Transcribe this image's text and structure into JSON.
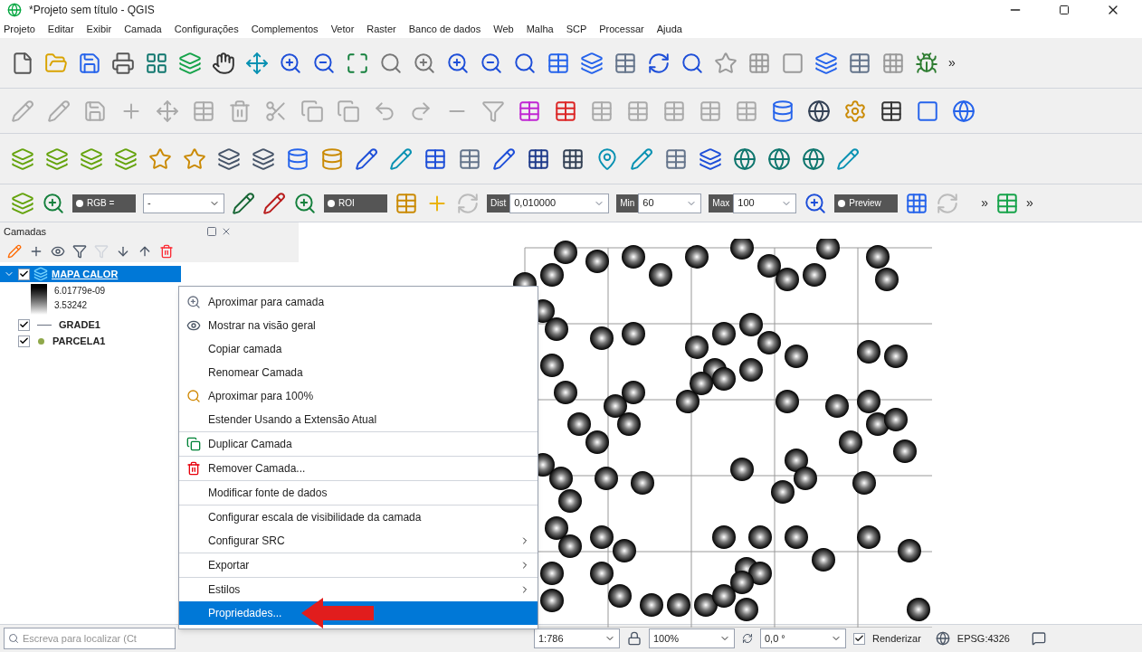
{
  "window": {
    "title": "*Projeto sem título - QGIS"
  },
  "menu": [
    "Projeto",
    "Editar",
    "Exibir",
    "Camada",
    "Configurações",
    "Complementos",
    "Vetor",
    "Raster",
    "Banco de dados",
    "Web",
    "Malha",
    "SCP",
    "Processar",
    "Ajuda"
  ],
  "toolbar_overflow": "»",
  "scp_toolbar": {
    "rgb_label": "RGB =",
    "rgb_value": "-",
    "roi_label": "ROI",
    "dist_label": "Dist",
    "dist_value": "0,010000",
    "min_label": "Min",
    "min_value": "60",
    "max_label": "Max",
    "max_value": "100",
    "preview_label": "Preview",
    "overflow": "»",
    "overflow_end": "»"
  },
  "layers_panel": {
    "title": "Camadas",
    "layers": [
      {
        "name": "MAPA CALOR",
        "kind": "raster",
        "checked": true,
        "selected": true,
        "expanded": true,
        "legend": [
          "6.01779e-09",
          "3.53242"
        ]
      },
      {
        "name": "GRADE1",
        "kind": "line",
        "checked": true,
        "selected": false
      },
      {
        "name": "PARCELA1",
        "kind": "point",
        "checked": true,
        "selected": false
      }
    ]
  },
  "context_menu": {
    "groups": [
      [
        {
          "label": "Aproximar para camada",
          "kind": "zoom",
          "submenu": false,
          "selected": false
        },
        {
          "label": "Mostrar na visão geral",
          "kind": "overview",
          "submenu": false,
          "selected": false
        },
        {
          "label": "Copiar camada",
          "kind": "plain",
          "submenu": false,
          "selected": false
        },
        {
          "label": "Renomear Camada",
          "kind": "plain",
          "submenu": false,
          "selected": false
        },
        {
          "label": "Aproximar para 100%",
          "kind": "native",
          "submenu": false,
          "selected": false
        },
        {
          "label": "Estender Usando a Extensão Atual",
          "kind": "plain",
          "submenu": false,
          "selected": false
        }
      ],
      [
        {
          "label": "Duplicar Camada",
          "kind": "duplicate",
          "submenu": false,
          "selected": false
        }
      ],
      [
        {
          "label": "Remover Camada...",
          "kind": "remove",
          "submenu": false,
          "selected": false
        }
      ],
      [
        {
          "label": "Modificar fonte de dados",
          "kind": "plain",
          "submenu": false,
          "selected": false
        }
      ],
      [
        {
          "label": "Configurar escala de visibilidade da camada",
          "kind": "plain",
          "submenu": false,
          "selected": false
        },
        {
          "label": "Configurar SRC",
          "kind": "plain",
          "submenu": true,
          "selected": false
        }
      ],
      [
        {
          "label": "Exportar",
          "kind": "plain",
          "submenu": true,
          "selected": false
        }
      ],
      [
        {
          "label": "Estilos",
          "kind": "plain",
          "submenu": true,
          "selected": false
        },
        {
          "label": "Propriedades...",
          "kind": "plain",
          "submenu": false,
          "selected": true
        }
      ]
    ]
  },
  "status_bar": {
    "search_placeholder": "Escreva para localizar (Ct",
    "scale": "1:786",
    "magnifier": "100%",
    "rotation": "0,0 °",
    "render_label": "Renderizar",
    "render_checked": true,
    "crs": "EPSG:4326"
  }
}
